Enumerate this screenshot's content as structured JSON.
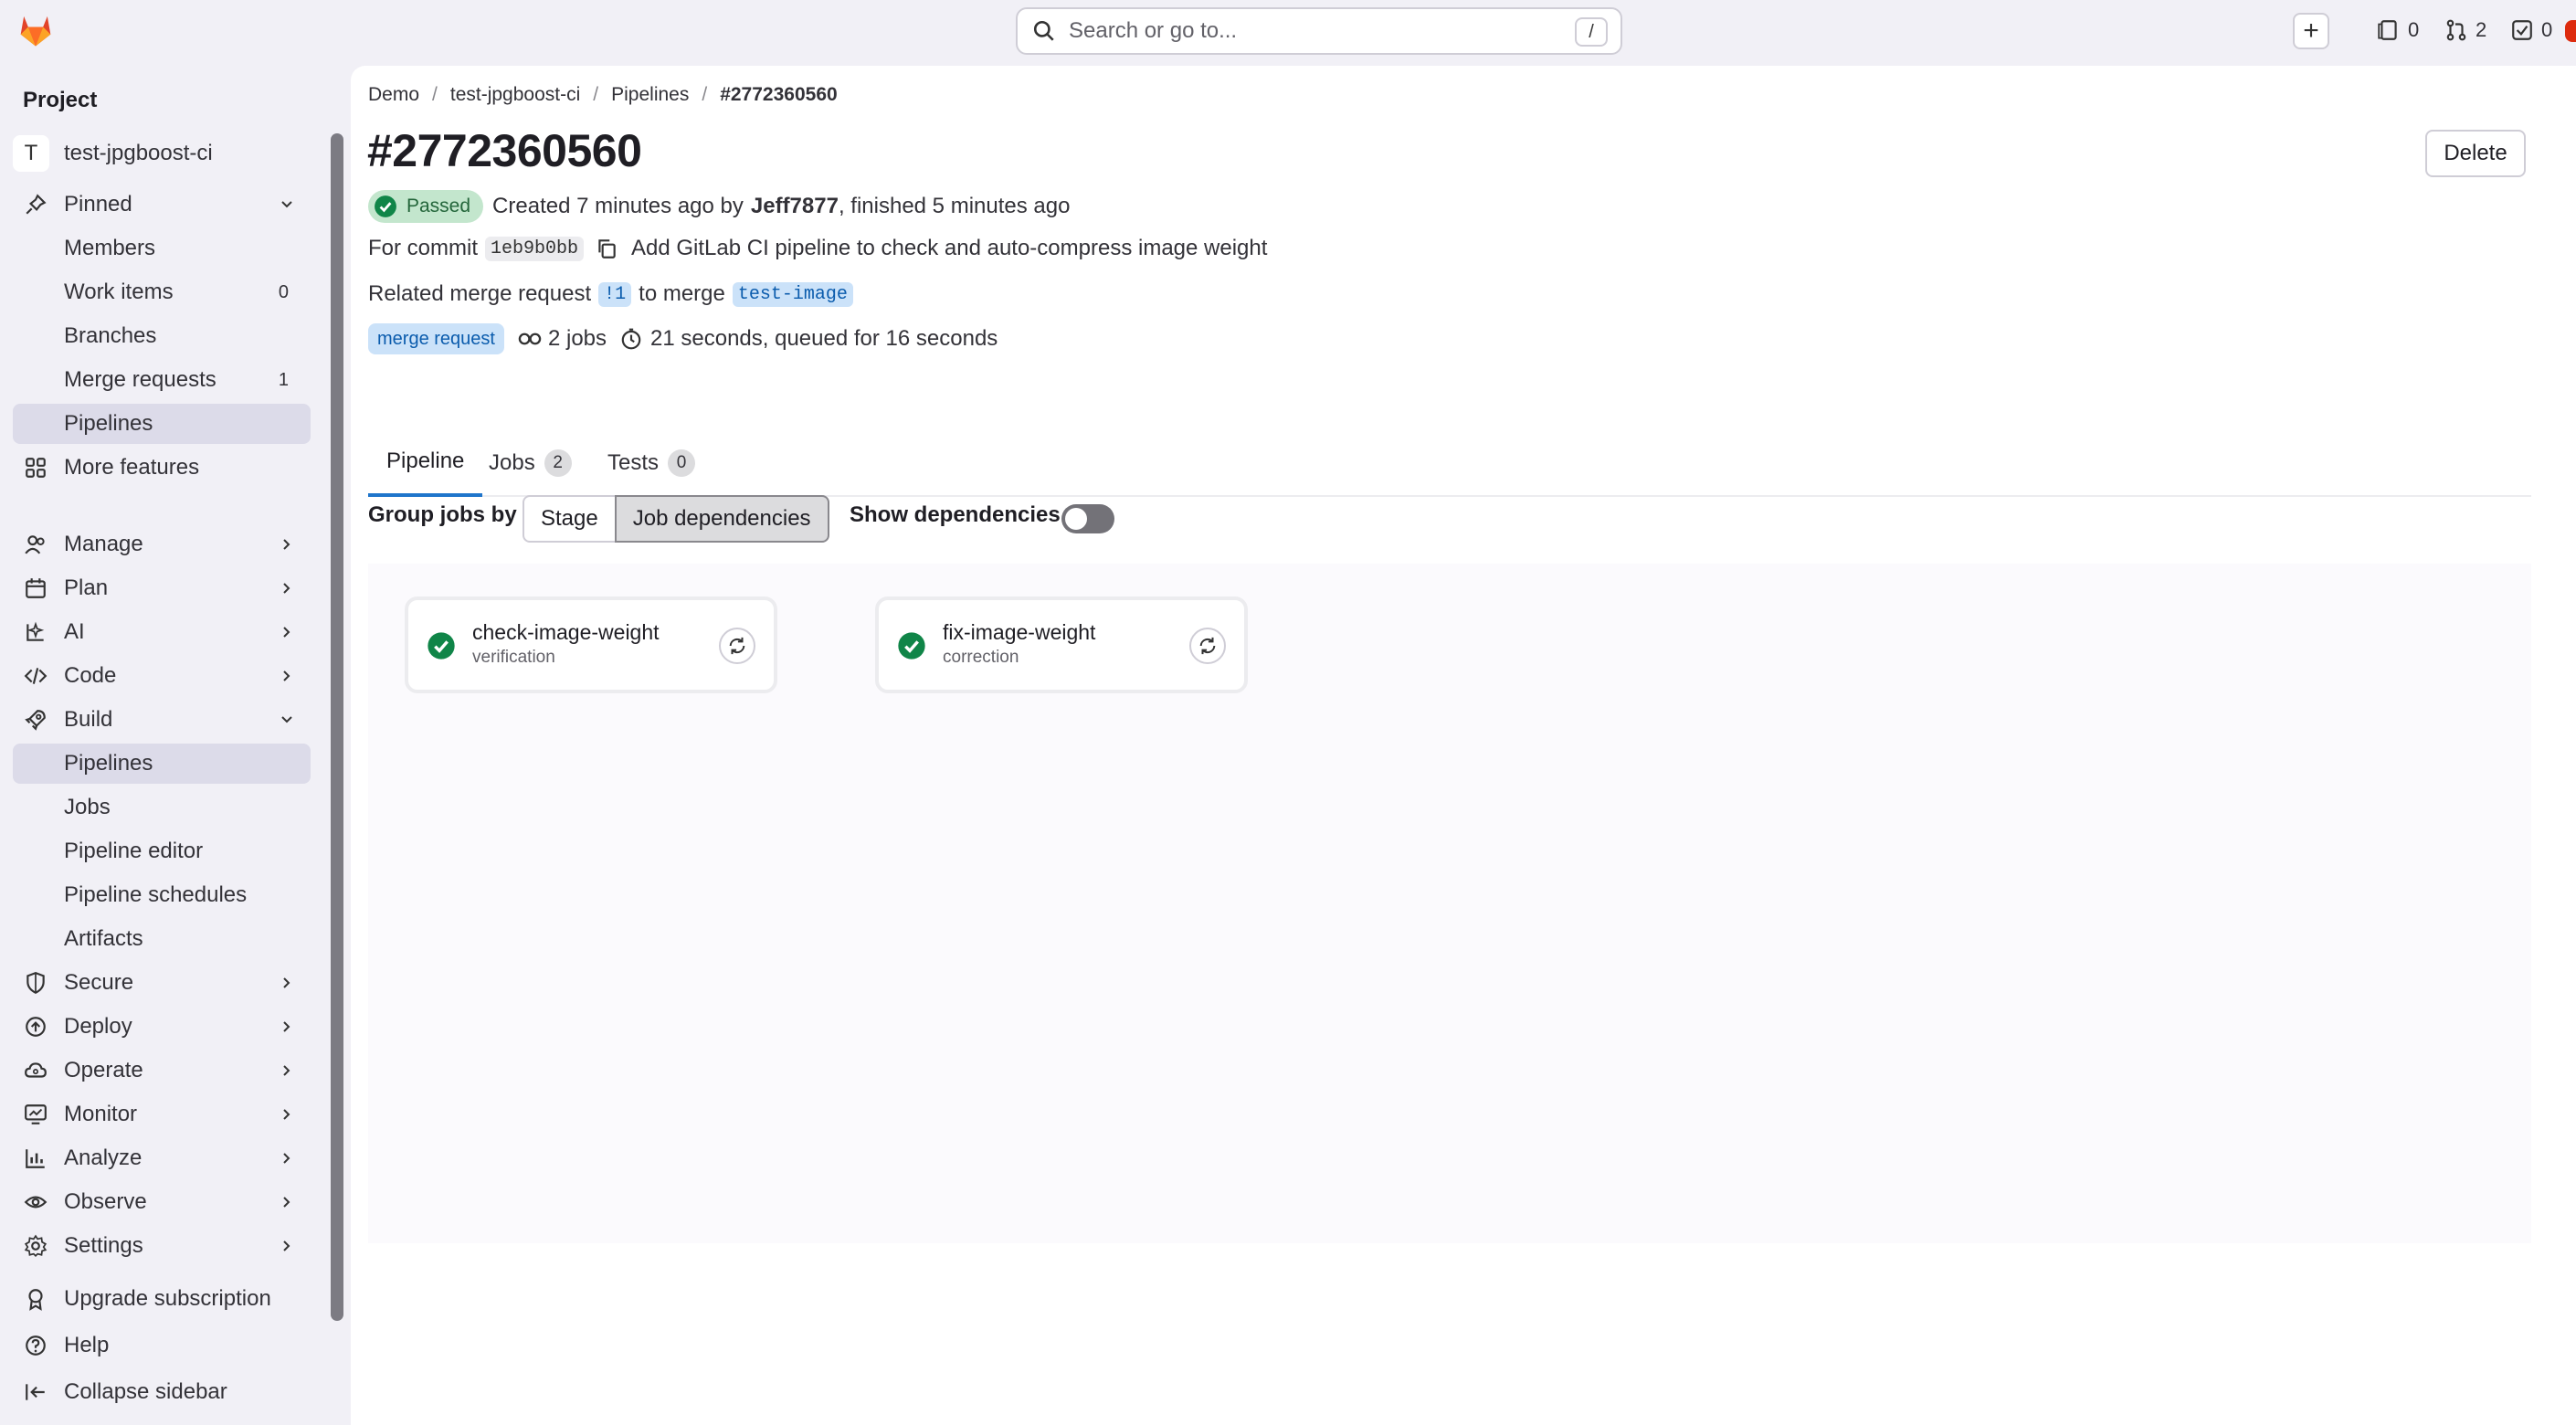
{
  "topbar": {
    "search_placeholder": "Search or go to...",
    "search_shortcut": "/",
    "plus": "+",
    "issues_count": "0",
    "mr_count": "2",
    "todo_count": "0"
  },
  "sidebar": {
    "heading": "Project",
    "project_initial": "T",
    "project_name": "test-jpgboost-ci",
    "pinned": "Pinned",
    "pinned_items": [
      {
        "label": "Members",
        "count": ""
      },
      {
        "label": "Work items",
        "count": "0"
      },
      {
        "label": "Branches",
        "count": ""
      },
      {
        "label": "Merge requests",
        "count": "1"
      },
      {
        "label": "Pipelines",
        "count": ""
      }
    ],
    "more_features": "More features",
    "sections": [
      {
        "label": "Manage"
      },
      {
        "label": "Plan"
      },
      {
        "label": "AI"
      },
      {
        "label": "Code"
      },
      {
        "label": "Build"
      }
    ],
    "build_items": [
      {
        "label": "Pipelines"
      },
      {
        "label": "Jobs"
      },
      {
        "label": "Pipeline editor"
      },
      {
        "label": "Pipeline schedules"
      },
      {
        "label": "Artifacts"
      }
    ],
    "more_sections": [
      {
        "label": "Secure"
      },
      {
        "label": "Deploy"
      },
      {
        "label": "Operate"
      },
      {
        "label": "Monitor"
      },
      {
        "label": "Analyze"
      },
      {
        "label": "Observe"
      },
      {
        "label": "Settings"
      }
    ],
    "footer": {
      "upgrade": "Upgrade subscription",
      "help": "Help",
      "collapse": "Collapse sidebar"
    }
  },
  "breadcrumb": [
    "Demo",
    "test-jpgboost-ci",
    "Pipelines",
    "#2772360560"
  ],
  "pipeline": {
    "title": "#2772360560",
    "delete_label": "Delete",
    "status": "Passed",
    "created_text": "Created 7 minutes ago by",
    "author": "Jeff7877",
    "finished_text": ", finished 5 minutes ago",
    "commit_prefix": "For commit",
    "commit_sha": "1eb9b0bb",
    "commit_message": "Add GitLab CI pipeline to check and auto-compress image weight",
    "mr_prefix": "Related merge request",
    "mr_ref": "!1",
    "mr_to": "to merge",
    "mr_branch": "test-image",
    "tag": "merge request",
    "jobs_count": "2 jobs",
    "duration": "21 seconds, queued for 16 seconds"
  },
  "tabs": [
    {
      "label": "Pipeline",
      "count": ""
    },
    {
      "label": "Jobs",
      "count": "2"
    },
    {
      "label": "Tests",
      "count": "0"
    }
  ],
  "graph_controls": {
    "group_label": "Group jobs by",
    "stage_btn": "Stage",
    "dependencies_btn": "Job dependencies",
    "show_deps_label": "Show dependencies"
  },
  "jobs": [
    {
      "name": "check-image-weight",
      "stage": "verification"
    },
    {
      "name": "fix-image-weight",
      "stage": "correction"
    }
  ],
  "colors": {
    "accent": "#1f75cb",
    "success": "#108548",
    "brand": "#fc6d26"
  }
}
